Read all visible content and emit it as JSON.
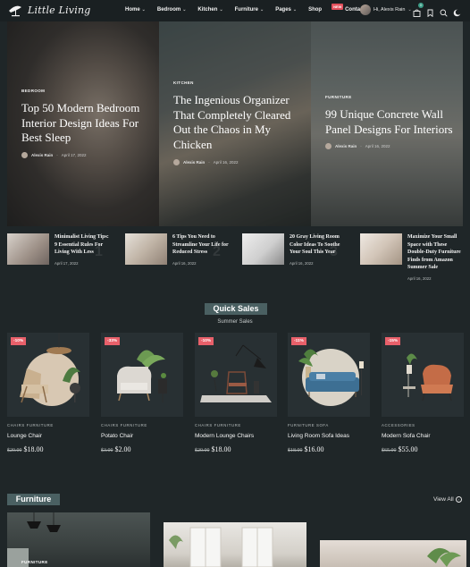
{
  "header": {
    "logo_text": "Little Living",
    "nav": [
      {
        "label": "Home",
        "dropdown": true
      },
      {
        "label": "Bedroom",
        "dropdown": true
      },
      {
        "label": "Kitchen",
        "dropdown": true
      },
      {
        "label": "Furniture",
        "dropdown": true
      },
      {
        "label": "Pages",
        "dropdown": true
      },
      {
        "label": "Shop",
        "dropdown": false,
        "badge": "NEW"
      },
      {
        "label": "Contact",
        "dropdown": false
      }
    ],
    "user_greeting": "Hi, Alexis Rain",
    "cart_count": "0",
    "icons": [
      "cart-icon",
      "bookmark-icon",
      "search-icon",
      "dark-mode-icon"
    ]
  },
  "hero": [
    {
      "category": "BEDROOM",
      "title": "Top 50 Modern Bedroom Interior Design Ideas For Best Sleep",
      "author": "Alexis Rain",
      "date": "April 17, 2022"
    },
    {
      "category": "KITCHEN",
      "title": "The Ingenious Organizer That Completely Cleared Out the Chaos in My Chicken",
      "author": "Alexis Rain",
      "date": "April 16, 2022"
    },
    {
      "category": "FURNITURE",
      "title": "99 Unique Concrete Wall Panel Designs For Interiors",
      "author": "Alexis Rain",
      "date": "April 16, 2022"
    }
  ],
  "posts": [
    {
      "title": "Minimalist Living Tips: 9 Essential Rules For Living With Less",
      "date": "April 17, 2022",
      "num": "1"
    },
    {
      "title": "6 Tips You Need to Streamline Your Life for Reduced Stress",
      "date": "April 16, 2022",
      "num": "2"
    },
    {
      "title": "20 Gray Living Room Color Ideas To Soothe Your Soul This Year",
      "date": "April 16, 2022",
      "num": "3"
    },
    {
      "title": "Maximize Your Small Space with These Double-Duty Furniture Finds from Amazon Summer Sale",
      "date": "April 16, 2022",
      "num": "4"
    }
  ],
  "quick_sales": {
    "title": "Quick Sales",
    "subtitle": "Summer Sales",
    "products": [
      {
        "discount": "-10%",
        "categories": "CHAIRS  FURNITURE",
        "name": "Lounge Chair",
        "old_price": "$20.00",
        "price": "$18.00"
      },
      {
        "discount": "-33%",
        "categories": "CHAIRS  FURNITURE",
        "name": "Potato Chair",
        "old_price": "$3.00",
        "price": "$2.00"
      },
      {
        "discount": "-10%",
        "categories": "CHAIRS  FURNITURE",
        "name": "Modern Lounge Chairs",
        "old_price": "$20.00",
        "price": "$18.00"
      },
      {
        "discount": "-11%",
        "categories": "FURNITURE  SOFA",
        "name": "Living Room Sofa Ideas",
        "old_price": "$18.00",
        "price": "$16.00"
      },
      {
        "discount": "-15%",
        "categories": "ACCESSORIES",
        "name": "Modern Sofa Chair",
        "old_price": "$65.00",
        "price": "$55.00"
      }
    ]
  },
  "furniture": {
    "title": "Furniture",
    "view_all": "View All",
    "card_category": "FURNITURE"
  },
  "colors": {
    "background": "#1f2628",
    "accent": "#4a6062",
    "discount": "#e8606a"
  }
}
